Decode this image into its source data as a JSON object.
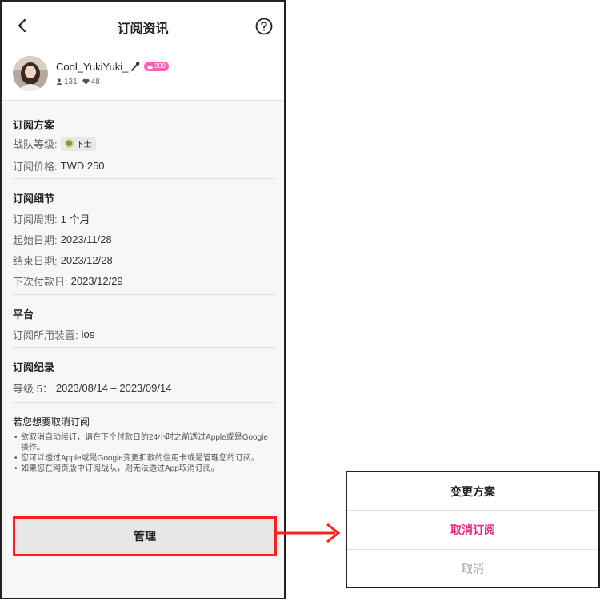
{
  "header": {
    "title": "订阅资讯"
  },
  "profile": {
    "username": "Cool_YukiYuki_",
    "level": "200",
    "followers": "131",
    "likes": "48"
  },
  "plan": {
    "title": "订阅方案",
    "rank_label": "战队等级:",
    "rank_value": "下士",
    "price_label": "订阅价格:",
    "price_value": "TWD 250"
  },
  "details": {
    "title": "订阅细节",
    "period_label": "订阅周期:",
    "period_value": "1 个月",
    "start_label": "起始日期:",
    "start_value": "2023/11/28",
    "end_label": "结束日期:",
    "end_value": "2023/12/28",
    "next_label": "下次付款日:",
    "next_value": "2023/12/29"
  },
  "platform": {
    "title": "平台",
    "device_label": "订阅所用装置:",
    "device_value": "ios"
  },
  "history": {
    "title": "订阅纪录",
    "entry_label": "等级 5：",
    "entry_value": "2023/08/14 – 2023/09/14"
  },
  "cancel_info": {
    "title": "若您想要取消订阅",
    "notes": [
      "欲取消自动续订，请在下个付款日的24小时之前透过Apple或是Google操作。",
      "您可以透过Apple或是Google变更扣款的信用卡或是管理您的订阅。",
      "如果您在网页版中订阅战队，则无法透过App取消订阅。"
    ]
  },
  "manage_button": "管理",
  "action_sheet": {
    "title": "变更方案",
    "cancel_subscription": "取消订阅",
    "dismiss": "取消"
  },
  "colors": {
    "accent_pink": "#e9287a",
    "highlight_red": "#ff1f1f",
    "level_badge": "#ff5fb4"
  }
}
